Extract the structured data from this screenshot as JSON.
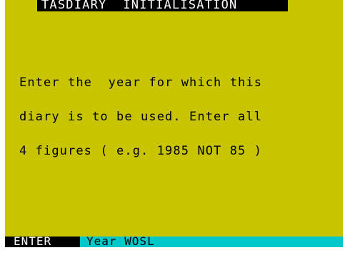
{
  "screen": {
    "title": "TASDIARY  INITIALISATION",
    "message_lines": [
      "Enter the  year for which this",
      "diary is to be used. Enter all",
      "4 figures ( e.g. 1985 NOT 85 )"
    ]
  },
  "status": {
    "key_label": "ENTER",
    "value_text": "Year WOSL"
  },
  "colors": {
    "background": "#c8c400",
    "title_bar": "#000000",
    "status_bar": "#00c7c9",
    "text": "#000000",
    "inverse_text": "#ffffff"
  }
}
